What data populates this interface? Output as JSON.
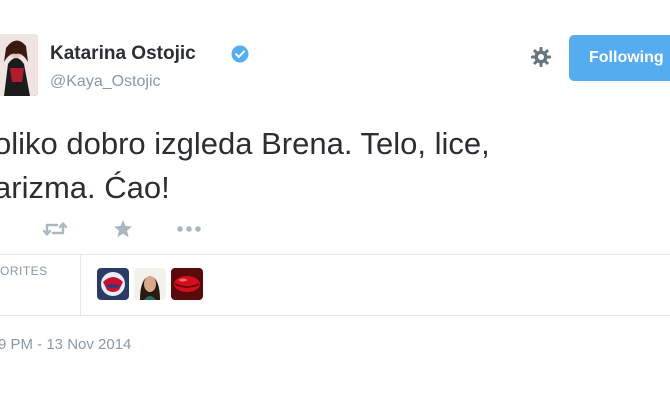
{
  "user": {
    "name": "Katarina Ostojic",
    "handle": "@Kaya_Ostojic",
    "verified": true
  },
  "follow_button": {
    "label": "Following"
  },
  "tweet": {
    "line1": "oliko dobro izgleda Brena. Telo, lice,",
    "line2": "arizma. Ćao!"
  },
  "favorites": {
    "label": "ORITES"
  },
  "timestamp": "9 PM - 13 Nov 2014",
  "colors": {
    "accent": "#55acee",
    "muted": "#8899a6",
    "border": "#e1e8ed",
    "text": "#292f33"
  },
  "icons": [
    "retweet-icon",
    "favorite-star-icon",
    "more-icon",
    "gear-icon",
    "verified-badge-icon"
  ]
}
